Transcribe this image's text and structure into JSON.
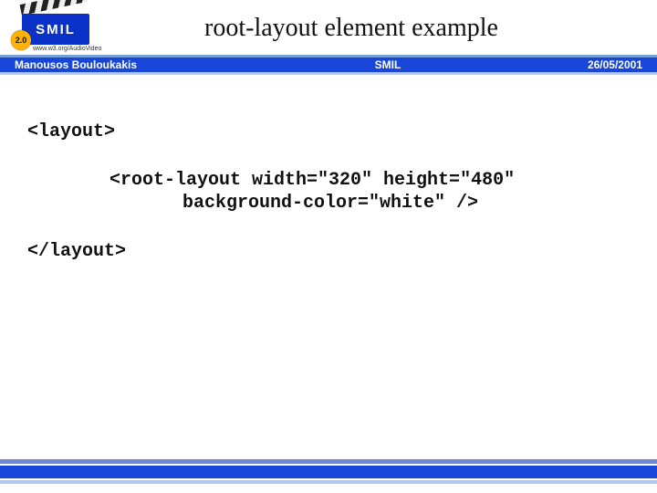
{
  "logo": {
    "text": "SMIL",
    "badge": "2.0",
    "url": "www.w3.org/AudioVideo"
  },
  "title": "root-layout element example",
  "bar": {
    "author": "Manousos Bouloukakis",
    "center": "SMIL",
    "date": "26/05/2001"
  },
  "code": {
    "open": "<layout>",
    "line1": "<root-layout width=\"320\" height=\"480\"",
    "line2": "background-color=\"white\" />",
    "close": "</layout>"
  }
}
